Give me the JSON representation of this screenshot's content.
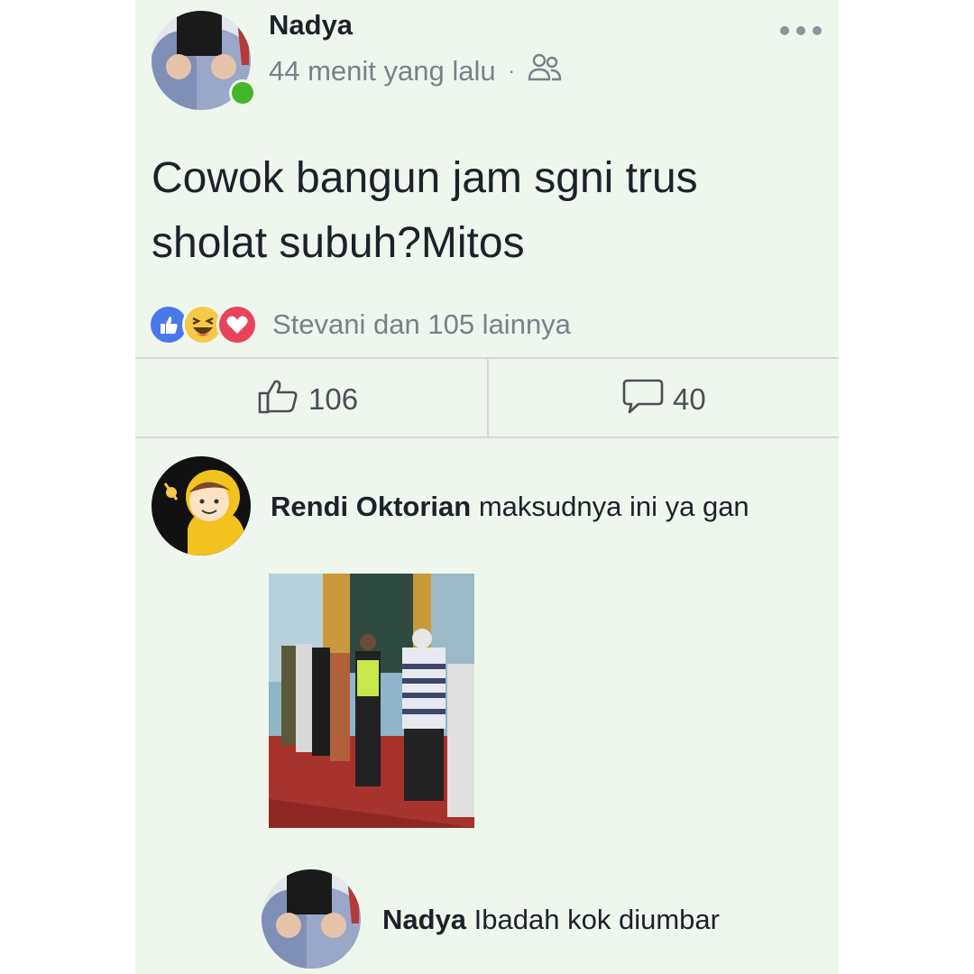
{
  "post": {
    "author": "Nadya",
    "time": "44 menit yang lalu",
    "separator": "·",
    "audience_icon": "friends-icon",
    "text_line1": "Cowok bangun jam sgni trus",
    "text_line2": "sholat subuh?Mitos",
    "reactions_summary": "Stevani dan 105 lainnya",
    "reaction_icons": [
      "like-reaction-icon",
      "haha-reaction-icon",
      "love-reaction-icon"
    ],
    "like_count": "106",
    "comment_count": "40"
  },
  "comments": [
    {
      "author": "Rendi Oktorian",
      "text": "maksudnya ini ya gan"
    },
    {
      "author": "Nadya",
      "text": "Ibadah kok diumbar"
    }
  ],
  "colors": {
    "card_bg": "#eef6ee",
    "online": "#42b72a",
    "like_blue": "#4a78e8",
    "love_red": "#e9435a",
    "haha_yellow": "#f7c948"
  }
}
